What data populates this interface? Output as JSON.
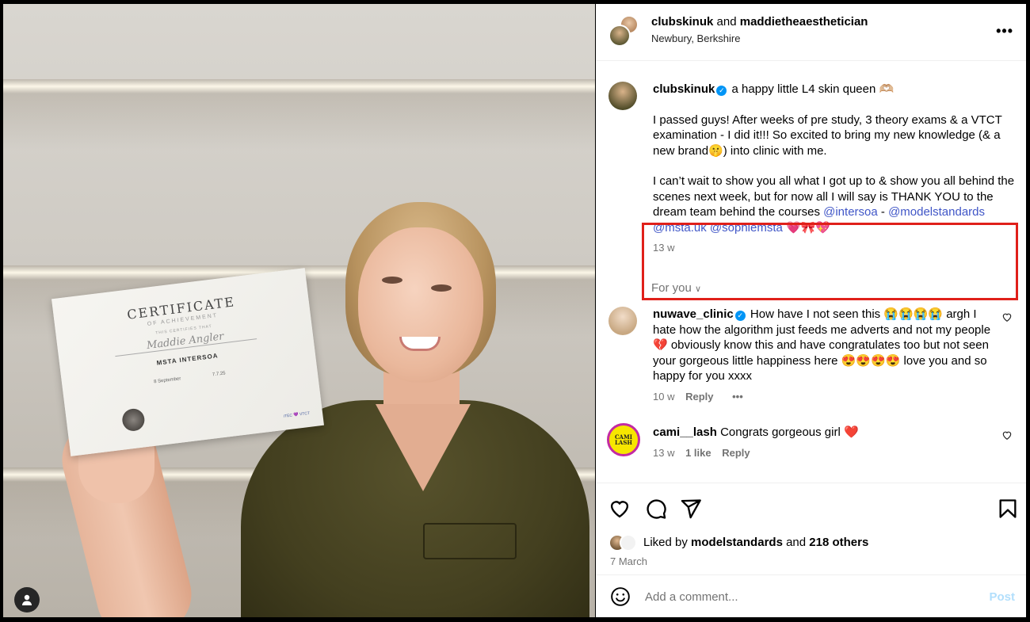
{
  "header": {
    "user1": "clubskinuk",
    "joiner": "and",
    "user2": "maddietheaesthetician",
    "location": "Newbury, Berkshire",
    "more_label": "•••"
  },
  "caption": {
    "username": "clubskinuk",
    "headline": "a happy little L4 skin queen 🫶🏼",
    "para1": "I passed guys! After weeks of pre study, 3 theory exams & a VTCT examination - I did it!!! So excited to bring my new knowledge (& a new brand🤫) into clinic with me.",
    "para2_text": "I can’t wait to show you all what I got up to & show you all behind the scenes next week, but for now all I will say is THANK YOU to the dream team behind the courses ",
    "mention1": "@intersoa",
    "dash": " -",
    "mention2": "@modelstandards",
    "mention3": "@msta.uk",
    "mention4": "@sophiemsta",
    "para2_end": " 💗🎀💖",
    "time": "13 w"
  },
  "for_you": "For you",
  "comments": [
    {
      "username": "nuwave_clinic",
      "text": "How have I not seen this 😭😭😭😭 argh I hate how the algorithm just feeds me adverts and not my people 💔 obviously know this and have congratulates too but not seen your gorgeous little happiness here 😍😍😍😍 love you and so happy for you xxxx",
      "time": "10 w",
      "reply": "Reply",
      "more": "•••"
    },
    {
      "username": "cami__lash",
      "avatar_text": "CAMI LASH",
      "text": "Congrats gorgeous girl ❤️",
      "time": "13 w",
      "likes": "1 like",
      "reply": "Reply"
    }
  ],
  "liked": {
    "prefix": "Liked by",
    "user": "modelstandards",
    "joiner": "and",
    "others": "218 others"
  },
  "date": "7 March",
  "add_comment": {
    "placeholder": "Add a comment...",
    "post": "Post"
  },
  "certificate": {
    "title": "CERTIFICATE",
    "subtitle": "OF ACHIEVEMENT",
    "certifies": "THIS CERTIFIES THAT",
    "name": "Maddie Angler",
    "org": "MSTA  INTERSOA",
    "sig_left": "8 September",
    "sig_right": "7.7.25",
    "logos": "iTEC 💜 VTCT"
  },
  "colors": {
    "mention": "#4056c7",
    "highlight": "#e0201a",
    "verified": "#0095f6",
    "post_button": "#b2dffc"
  }
}
